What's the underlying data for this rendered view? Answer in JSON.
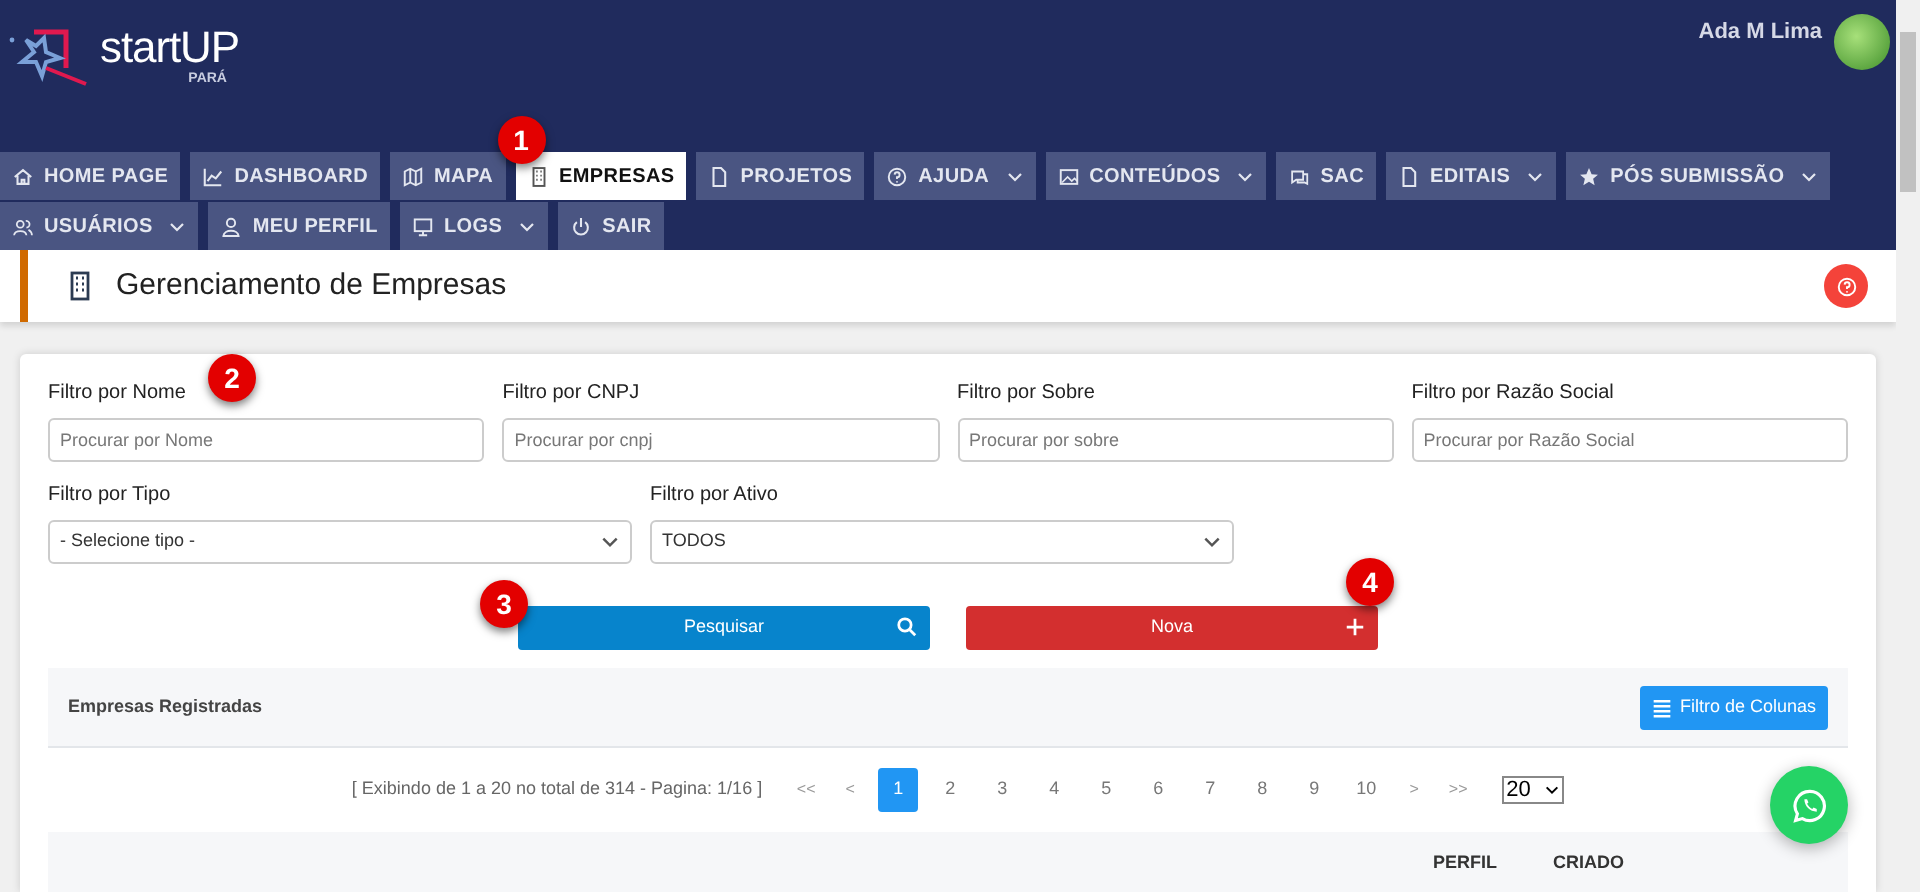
{
  "header": {
    "logo_text": "startUP",
    "logo_subtext": "PARÁ",
    "user_name": "Ada M Lima"
  },
  "nav": {
    "rows": [
      [
        {
          "kind": "home",
          "label": "HOME PAGE",
          "dropdown": false,
          "selected": false
        },
        {
          "kind": "chart",
          "label": "DASHBOARD",
          "dropdown": false,
          "selected": false
        },
        {
          "kind": "map",
          "label": "MAPA",
          "dropdown": false,
          "selected": false
        },
        {
          "kind": "building",
          "label": "EMPRESAS",
          "dropdown": false,
          "selected": true,
          "marker": "1"
        },
        {
          "kind": "file",
          "label": "PROJETOS",
          "dropdown": false,
          "selected": false
        },
        {
          "kind": "help",
          "label": "AJUDA",
          "dropdown": true,
          "selected": false
        },
        {
          "kind": "image",
          "label": "CONTEÚDOS",
          "dropdown": true,
          "selected": false
        },
        {
          "kind": "chat",
          "label": "SAC",
          "dropdown": false,
          "selected": false
        },
        {
          "kind": "file",
          "label": "EDITAIS",
          "dropdown": true,
          "selected": false
        },
        {
          "kind": "star",
          "label": "PÓS SUBMISSÃO",
          "dropdown": true,
          "selected": false
        }
      ],
      [
        {
          "kind": "users",
          "label": "USUÁRIOS",
          "dropdown": true,
          "selected": false
        },
        {
          "kind": "user",
          "label": "MEU PERFIL",
          "dropdown": false,
          "selected": false
        },
        {
          "kind": "monitor",
          "label": "LOGS",
          "dropdown": true,
          "selected": false
        },
        {
          "kind": "power",
          "label": "SAIR",
          "dropdown": false,
          "selected": false
        }
      ]
    ]
  },
  "page_title": "Gerenciamento de Empresas",
  "filters": {
    "text_fields": [
      {
        "label": "Filtro por Nome",
        "placeholder": "Procurar por Nome",
        "marker": "2"
      },
      {
        "label": "Filtro por CNPJ",
        "placeholder": "Procurar por cnpj"
      },
      {
        "label": "Filtro por Sobre",
        "placeholder": "Procurar por sobre"
      },
      {
        "label": "Filtro por Razão Social",
        "placeholder": "Procurar por Razão Social"
      }
    ],
    "selects": [
      {
        "label": "Filtro por Tipo",
        "value": "- Selecione tipo -"
      },
      {
        "label": "Filtro por Ativo",
        "value": "TODOS"
      }
    ]
  },
  "actions": [
    {
      "kind": "search",
      "label": "Pesquisar",
      "marker": "3"
    },
    {
      "kind": "new",
      "label": "Nova",
      "marker": "4"
    }
  ],
  "table": {
    "title": "Empresas Registradas",
    "column_filter_button": "Filtro de Colunas",
    "pagination": {
      "summary": "[ Exibindo de 1 a 20 no total de 314 - Pagina: 1/16 ]",
      "first": "<<",
      "prev": "<",
      "next": ">",
      "last": ">>",
      "pages": [
        {
          "label": "1",
          "selected": true
        },
        {
          "label": "2",
          "selected": false
        },
        {
          "label": "3",
          "selected": false
        },
        {
          "label": "4",
          "selected": false
        },
        {
          "label": "5",
          "selected": false
        },
        {
          "label": "6",
          "selected": false
        },
        {
          "label": "7",
          "selected": false
        },
        {
          "label": "8",
          "selected": false
        },
        {
          "label": "9",
          "selected": false
        },
        {
          "label": "10",
          "selected": false
        }
      ],
      "page_size": "20"
    },
    "columns": [
      "PERFIL",
      "CRIADO"
    ]
  }
}
